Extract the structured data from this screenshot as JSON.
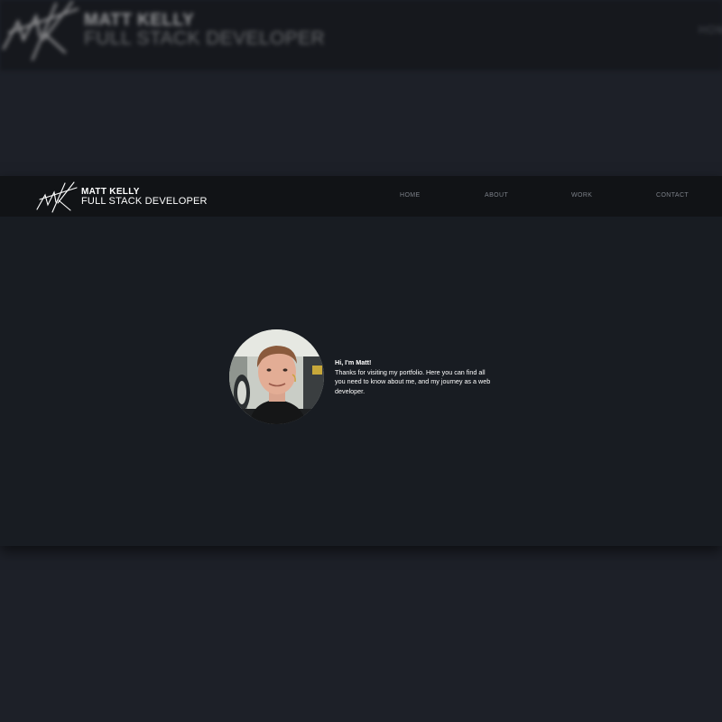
{
  "background_page": {
    "name": "MATT KELLY",
    "title": "FULL STACK DEVELOPER",
    "nav_partial": "HOM"
  },
  "header": {
    "name": "MATT KELLY",
    "title": "FULL STACK DEVELOPER",
    "logo_text": "MK"
  },
  "nav": {
    "items": [
      {
        "label": "HOME"
      },
      {
        "label": "ABOUT"
      },
      {
        "label": "WORK"
      },
      {
        "label": "CONTACT"
      }
    ]
  },
  "intro": {
    "heading": "Hi, I'm Matt!",
    "body": "Thanks for visiting my portfolio. Here you can find all you need to know about me, and my journey as a web developer."
  },
  "colors": {
    "page_background": "#1d2028",
    "navbar": "#111316",
    "content": "#181c22",
    "nav_text": "#7c8088",
    "brand_text": "#ffffff"
  }
}
